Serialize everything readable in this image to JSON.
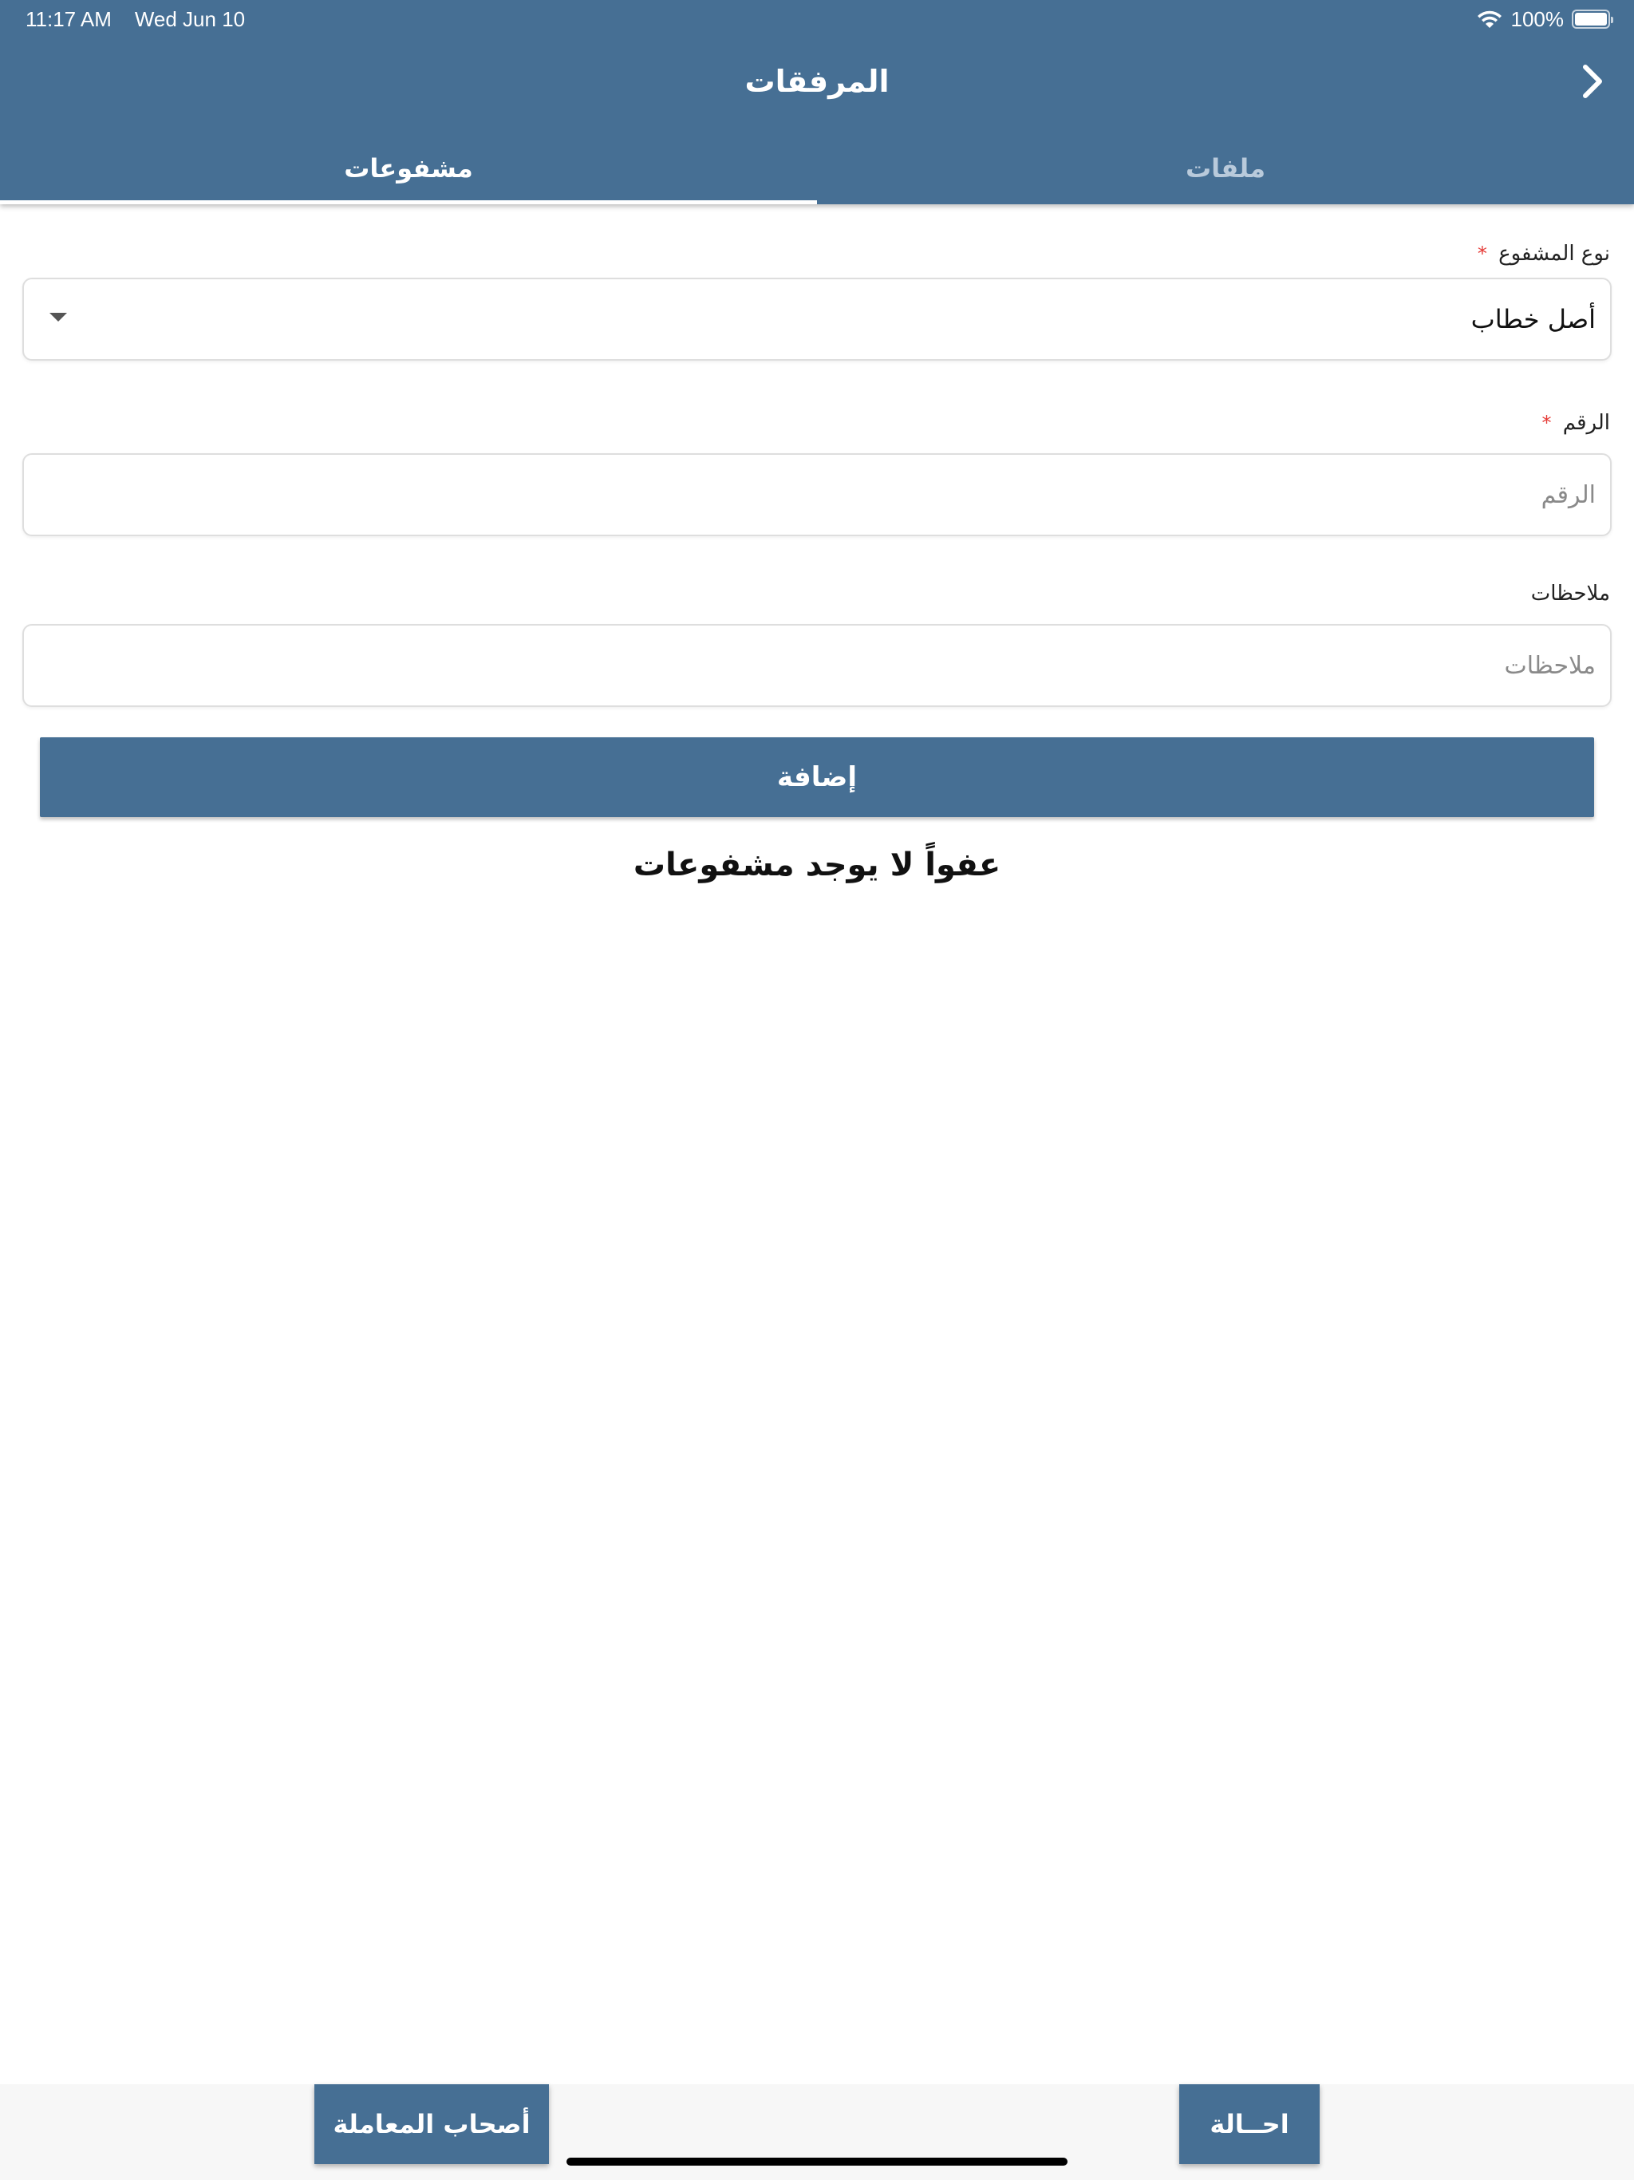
{
  "status_bar": {
    "time": "11:17 AM",
    "date": "Wed Jun 10",
    "battery_text": "100%",
    "battery_level": 1.0
  },
  "header": {
    "title": "المرفقات",
    "back_icon": "chevron-right-icon",
    "background_color": "#466f94"
  },
  "tabs": [
    {
      "label": "ملفات",
      "active": false
    },
    {
      "label": "مشفوعات",
      "active": true
    }
  ],
  "form": {
    "attachment_type": {
      "label": "نوع المشفوع",
      "required_mark": "*",
      "value": "أصل خطاب"
    },
    "number": {
      "label": "الرقم",
      "required_mark": "*",
      "placeholder": "الرقم",
      "value": ""
    },
    "notes": {
      "label": "ملاحظات",
      "placeholder": "ملاحظات",
      "value": ""
    },
    "add_button_label": "إضافة"
  },
  "empty_message": "عفواً لا يوجد مشفوعات",
  "bottom_bar": {
    "parties_button_label": "أصحاب المعاملة",
    "refer_button_label": "احــالة"
  },
  "colors": {
    "primary": "#466f94",
    "required": "#e53935"
  }
}
